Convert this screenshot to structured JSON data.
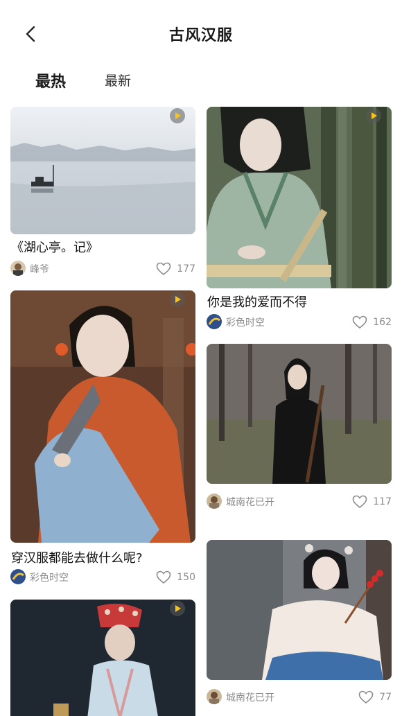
{
  "header": {
    "title": "古风汉服",
    "back_icon": "chevron-left-icon"
  },
  "tabs": [
    {
      "label": "最热",
      "active": true
    },
    {
      "label": "最新",
      "active": false
    }
  ],
  "cards": [
    {
      "title": "《湖心亭。记》",
      "author": "峰爷",
      "likes": "177",
      "has_play": true
    },
    {
      "title": "你是我的爱而不得",
      "author": "彩色时空",
      "likes": "162",
      "has_play": true
    },
    {
      "title": "穿汉服都能去做什么呢?",
      "author": "彩色时空",
      "likes": "150",
      "has_play": true
    },
    {
      "title": "",
      "author": "城南花已开",
      "likes": "117",
      "has_play": false
    },
    {
      "title": "",
      "author": "",
      "likes": "",
      "has_play": true
    },
    {
      "title": "",
      "author": "城南花已开",
      "likes": "77",
      "has_play": false
    }
  ],
  "colors": {
    "play_accent": "#f5c518",
    "meta_text": "#8c8c8c",
    "title_text": "#111111"
  }
}
